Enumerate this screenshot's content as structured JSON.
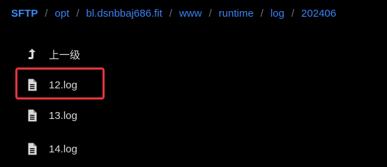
{
  "breadcrumb": {
    "root": "SFTP",
    "items": [
      "opt",
      "bl.dsnbbaj686.fit",
      "www",
      "runtime",
      "log",
      "202406"
    ],
    "separator": "/",
    "root_color": "#3b8cf7",
    "link_color": "#3b82f6"
  },
  "files": {
    "up_label": "上一级",
    "items": [
      {
        "name": "12.log",
        "icon": "file-icon"
      },
      {
        "name": "13.log",
        "icon": "file-icon"
      },
      {
        "name": "14.log",
        "icon": "file-icon"
      }
    ]
  },
  "highlight_color": "#e8353a"
}
